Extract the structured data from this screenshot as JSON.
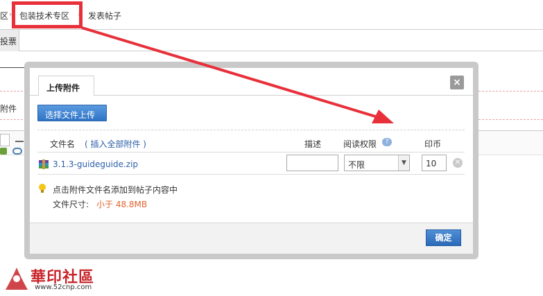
{
  "breadcrumb": {
    "cut_item": "区",
    "separator": "›",
    "section_link": "包装技术专区",
    "current": "发表帖子"
  },
  "background": {
    "tab_cut_label": "投票",
    "attach_cut_label": "附件"
  },
  "dialog": {
    "tab_label": "上传附件",
    "close_glyph": "×",
    "upload_button": "选择文件上传",
    "columns": {
      "file_name": "文件名",
      "insert_all": "( 插入全部附件 )",
      "description": "描述",
      "read_permission": "阅读权限",
      "help_glyph": "?",
      "coins": "印币"
    },
    "row": {
      "file_name": "3.1.3-guideguide.zip",
      "description_value": "",
      "read_permission_value": "不限",
      "coins_value": "10"
    },
    "tip": "点击附件文件名添加到帖子内容中",
    "size_label": "文件尺寸: ",
    "size_value": "小于 48.8MB",
    "ok_button": "确定"
  },
  "watermark": {
    "title": "華印社區",
    "url": "www.52cnp.com"
  },
  "colors": {
    "highlight": "#e8303a",
    "link": "#2b5ea8",
    "button": "#2f74c6",
    "size_value": "#e0622d"
  }
}
